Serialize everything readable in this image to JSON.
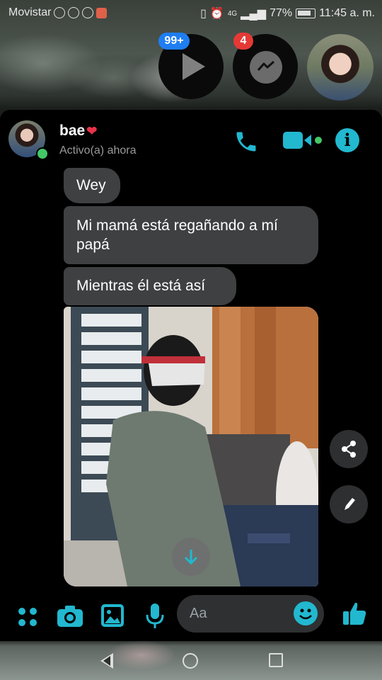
{
  "status_bar": {
    "carrier": "Movistar",
    "network": "4G",
    "battery": "77%",
    "time": "11:45 a. m."
  },
  "chat_heads": {
    "video_badge": "99+",
    "messenger_badge": "4"
  },
  "conversation": {
    "contact_name": "bae",
    "contact_status": "Activo(a) ahora",
    "messages": [
      {
        "text": "Wey"
      },
      {
        "text": "Mi mamá está regañando a mí papá"
      },
      {
        "text": "Mientras él está así"
      }
    ]
  },
  "composer": {
    "placeholder": "Aa"
  },
  "colors": {
    "accent": "#22b8cf",
    "bubble": "#3e4042",
    "online": "#44c767",
    "badge_blue": "#1e7ef2",
    "badge_red": "#e53935"
  },
  "icons": [
    "call-icon",
    "video-call-icon",
    "info-icon",
    "apps-icon",
    "camera-icon",
    "gallery-icon",
    "mic-icon",
    "emoji-icon",
    "like-icon",
    "share-icon",
    "edit-icon",
    "scroll-down-icon"
  ]
}
